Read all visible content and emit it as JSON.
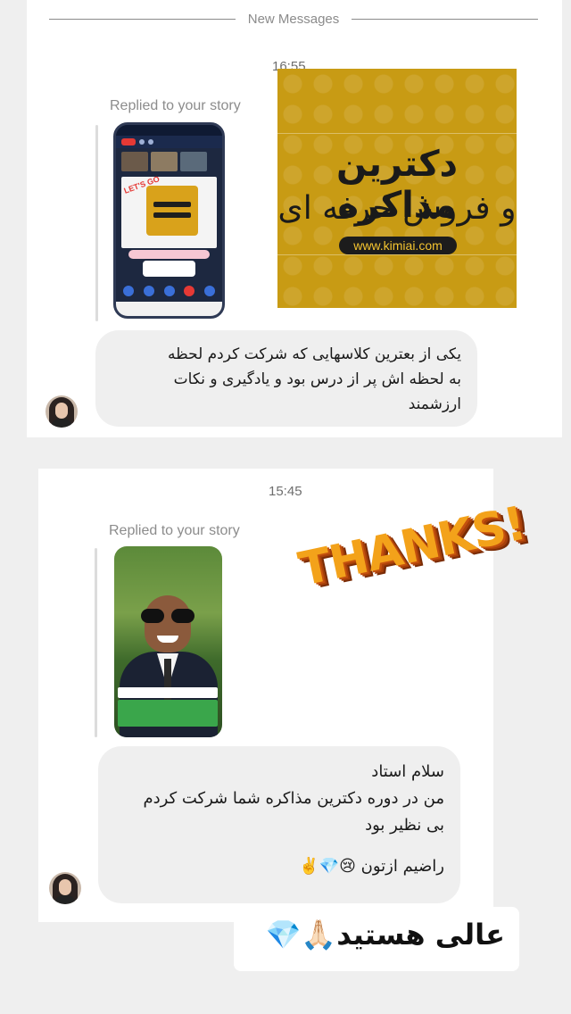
{
  "divider": {
    "label": "New Messages"
  },
  "message1": {
    "time": "16:55",
    "replied_label": "Replied to your story",
    "story_image": {
      "title_line1": "دکترین مذاکره",
      "title_line2": "و فروش حرفه ای",
      "url": "www.kimiai.com",
      "bg_color": "#c89b14"
    },
    "text_lines": [
      "یکی از بعترین کلاسهایی که شرکت کردم لحظه",
      "به لحظه اش پر از درس بود و یادگیری و نکات",
      "ارزشمند"
    ]
  },
  "message2": {
    "time": "15:45",
    "replied_label": "Replied to your story",
    "sticker": "THANKS!",
    "text_lines": [
      "سلام استاد",
      "من در دوره دکترین مذاکره شما شرکت کردم",
      "بی نظیر بود"
    ],
    "signature": "راضیم ازتون 😢💎✌️"
  },
  "overlay_sticker": {
    "text": "عالی هستید🙏🏻💎"
  },
  "colors": {
    "bubble": "#efefef",
    "card": "#ffffff",
    "background": "#efefef",
    "accent_gold": "#c89b14"
  }
}
